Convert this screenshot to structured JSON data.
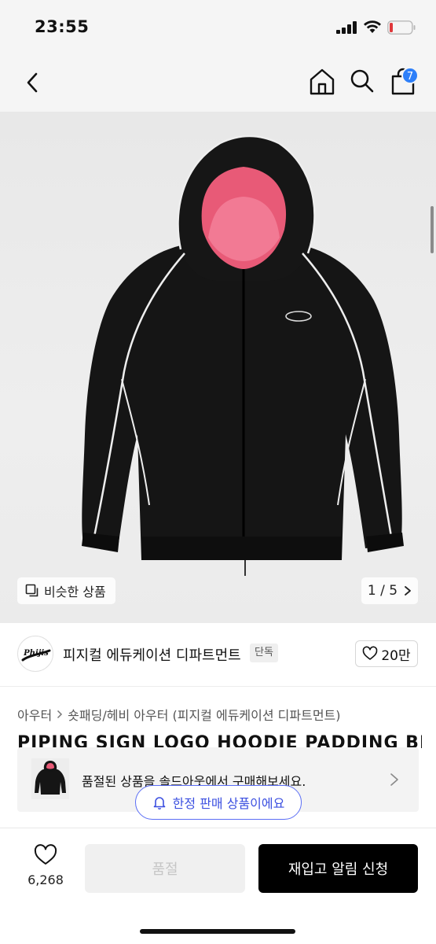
{
  "status_bar": {
    "time": "23:55"
  },
  "nav": {
    "cart_count": "7"
  },
  "gallery": {
    "similar_label": "비슷한 상품",
    "page_current": "1",
    "page_sep": "/",
    "page_total": "5"
  },
  "brand": {
    "logo_text": "Phijis",
    "name": "피지컬 에듀케이션 디파트먼트",
    "tag": "단독",
    "likes": "20만"
  },
  "breadcrumb": {
    "level1": "아우터",
    "level2": "숏패딩/헤비 아우터 (피지컬 에듀케이션 디파트먼트)"
  },
  "product": {
    "title": "PIPING SIGN LOGO HOODIE PADDING BLACK"
  },
  "soldout_banner": {
    "text": "품절된 상품을 솔드아웃에서 구매해보세요."
  },
  "limited_pill": {
    "text": "한정 판매 상품이에요"
  },
  "bottom_bar": {
    "wish_count": "6,268",
    "soldout_label": "품절",
    "restock_label": "재입고 알림 신청"
  },
  "colors": {
    "accent_blue": "#2d7ff9",
    "pill_blue": "#3b4fe0",
    "primary_button": "#000000"
  }
}
